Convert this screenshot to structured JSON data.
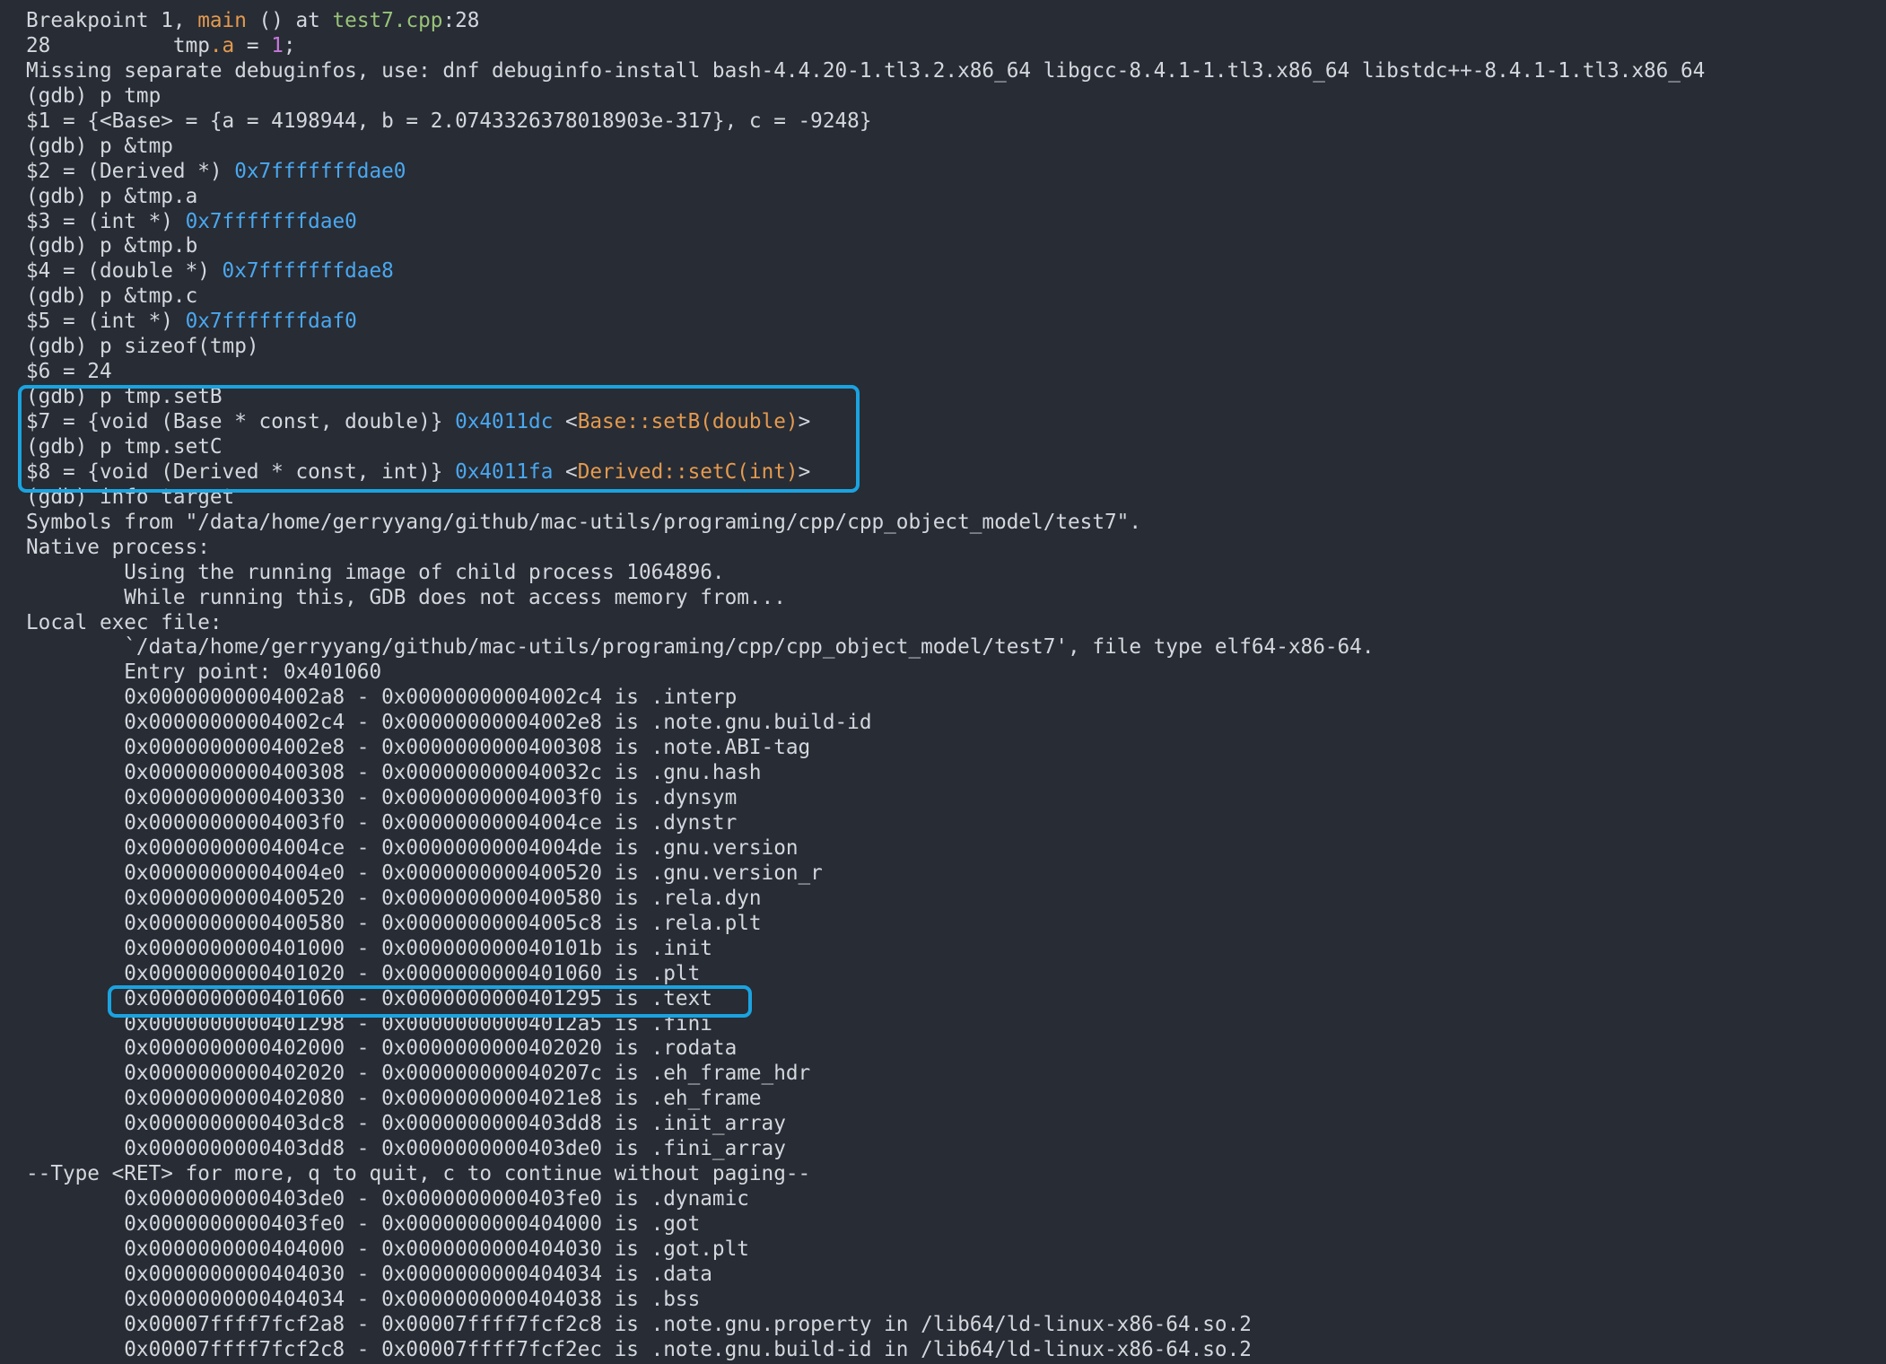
{
  "window": {
    "background": "#282c34",
    "highlight_color": "#1aa3e0",
    "colors": {
      "default_text": "#d4d7dd",
      "function_name": "#e39a4f",
      "file_name": "#98c379",
      "member": "#e39a4f",
      "number": "#c678dd",
      "address": "#4aa8f0",
      "symbol": "#e39a4f"
    }
  },
  "lines": [
    [
      {
        "t": "Breakpoint 1, "
      },
      {
        "t": "main",
        "c": "fn"
      },
      {
        "t": " () at "
      },
      {
        "t": "test7.cpp",
        "c": "file"
      },
      {
        "t": ":28"
      }
    ],
    [
      {
        "t": "28          tmp"
      },
      {
        "t": ".a",
        "c": "mem"
      },
      {
        "t": " = "
      },
      {
        "t": "1",
        "c": "num"
      },
      {
        "t": ";"
      }
    ],
    [
      {
        "t": "Missing separate debuginfos, use: dnf debuginfo-install bash-4.4.20-1.tl3.2.x86_64 libgcc-8.4.1-1.tl3.x86_64 libstdc++-8.4.1-1.tl3.x86_64"
      }
    ],
    [
      {
        "t": "(gdb) p tmp"
      }
    ],
    [
      {
        "t": "$1 = {<Base> = {a = 4198944, b = 2.0743326378018903e-317}, c = -9248}"
      }
    ],
    [
      {
        "t": "(gdb) p &tmp"
      }
    ],
    [
      {
        "t": "$2 = (Derived *) "
      },
      {
        "t": "0x7fffffffdae0",
        "c": "addr"
      }
    ],
    [
      {
        "t": "(gdb) p &tmp.a"
      }
    ],
    [
      {
        "t": "$3 = (int *) "
      },
      {
        "t": "0x7fffffffdae0",
        "c": "addr"
      }
    ],
    [
      {
        "t": "(gdb) p &tmp.b"
      }
    ],
    [
      {
        "t": "$4 = (double *) "
      },
      {
        "t": "0x7fffffffdae8",
        "c": "addr"
      }
    ],
    [
      {
        "t": "(gdb) p &tmp.c"
      }
    ],
    [
      {
        "t": "$5 = (int *) "
      },
      {
        "t": "0x7fffffffdaf0",
        "c": "addr"
      }
    ],
    [
      {
        "t": "(gdb) p sizeof(tmp)"
      }
    ],
    [
      {
        "t": "$6 = 24"
      }
    ],
    [
      {
        "t": "(gdb) p tmp.setB"
      }
    ],
    [
      {
        "t": "$7 = {void (Base * const, double)} "
      },
      {
        "t": "0x4011dc",
        "c": "addr"
      },
      {
        "t": " <"
      },
      {
        "t": "Base::setB(double)",
        "c": "sym"
      },
      {
        "t": ">"
      }
    ],
    [
      {
        "t": "(gdb) p tmp.setC"
      }
    ],
    [
      {
        "t": "$8 = {void (Derived * const, int)} "
      },
      {
        "t": "0x4011fa",
        "c": "addr"
      },
      {
        "t": " <"
      },
      {
        "t": "Derived::setC(int)",
        "c": "sym"
      },
      {
        "t": ">"
      }
    ],
    [
      {
        "t": "(gdb) info target"
      }
    ],
    [
      {
        "t": "Symbols from \"/data/home/gerryyang/github/mac-utils/programing/cpp/cpp_object_model/test7\"."
      }
    ],
    [
      {
        "t": "Native process:"
      }
    ],
    [
      {
        "t": "        Using the running image of child process 1064896."
      }
    ],
    [
      {
        "t": "        While running this, GDB does not access memory from..."
      }
    ],
    [
      {
        "t": "Local exec file:"
      }
    ],
    [
      {
        "t": "        `/data/home/gerryyang/github/mac-utils/programing/cpp/cpp_object_model/test7', file type elf64-x86-64."
      }
    ],
    [
      {
        "t": "        Entry point: 0x401060"
      }
    ],
    [
      {
        "t": "        0x00000000004002a8 - 0x00000000004002c4 is .interp"
      }
    ],
    [
      {
        "t": "        0x00000000004002c4 - 0x00000000004002e8 is .note.gnu.build-id"
      }
    ],
    [
      {
        "t": "        0x00000000004002e8 - 0x0000000000400308 is .note.ABI-tag"
      }
    ],
    [
      {
        "t": "        0x0000000000400308 - 0x000000000040032c is .gnu.hash"
      }
    ],
    [
      {
        "t": "        0x0000000000400330 - 0x00000000004003f0 is .dynsym"
      }
    ],
    [
      {
        "t": "        0x00000000004003f0 - 0x00000000004004ce is .dynstr"
      }
    ],
    [
      {
        "t": "        0x00000000004004ce - 0x00000000004004de is .gnu.version"
      }
    ],
    [
      {
        "t": "        0x00000000004004e0 - 0x0000000000400520 is .gnu.version_r"
      }
    ],
    [
      {
        "t": "        0x0000000000400520 - 0x0000000000400580 is .rela.dyn"
      }
    ],
    [
      {
        "t": "        0x0000000000400580 - 0x00000000004005c8 is .rela.plt"
      }
    ],
    [
      {
        "t": "        0x0000000000401000 - 0x000000000040101b is .init"
      }
    ],
    [
      {
        "t": "        0x0000000000401020 - 0x0000000000401060 is .plt"
      }
    ],
    [
      {
        "t": "        0x0000000000401060 - 0x0000000000401295 is .text"
      }
    ],
    [
      {
        "t": "        0x0000000000401298 - 0x00000000004012a5 is .fini"
      }
    ],
    [
      {
        "t": "        0x0000000000402000 - 0x0000000000402020 is .rodata"
      }
    ],
    [
      {
        "t": "        0x0000000000402020 - 0x000000000040207c is .eh_frame_hdr"
      }
    ],
    [
      {
        "t": "        0x0000000000402080 - 0x00000000004021e8 is .eh_frame"
      }
    ],
    [
      {
        "t": "        0x0000000000403dc8 - 0x0000000000403dd8 is .init_array"
      }
    ],
    [
      {
        "t": "        0x0000000000403dd8 - 0x0000000000403de0 is .fini_array"
      }
    ],
    [
      {
        "t": "--Type <RET> for more, q to quit, c to continue without paging--"
      }
    ],
    [
      {
        "t": "        0x0000000000403de0 - 0x0000000000403fe0 is .dynamic"
      }
    ],
    [
      {
        "t": "        0x0000000000403fe0 - 0x0000000000404000 is .got"
      }
    ],
    [
      {
        "t": "        0x0000000000404000 - 0x0000000000404030 is .got.plt"
      }
    ],
    [
      {
        "t": "        0x0000000000404030 - 0x0000000000404034 is .data"
      }
    ],
    [
      {
        "t": "        0x0000000000404034 - 0x0000000000404038 is .bss"
      }
    ],
    [
      {
        "t": "        0x00007ffff7fcf2a8 - 0x00007ffff7fcf2c8 is .note.gnu.property in /lib64/ld-linux-x86-64.so.2"
      }
    ],
    [
      {
        "t": "        0x00007ffff7fcf2c8 - 0x00007ffff7fcf2ec is .note.gnu.build-id in /lib64/ld-linux-x86-64.so.2"
      }
    ]
  ]
}
